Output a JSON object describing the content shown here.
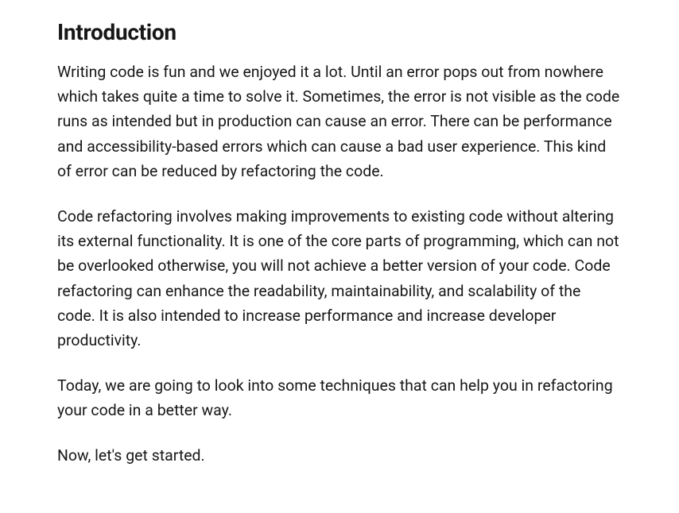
{
  "section": {
    "heading": "Introduction",
    "paragraphs": [
      "Writing code is fun and we enjoyed it a lot. Until an error pops out from nowhere which takes quite a time to solve it. Sometimes, the error is not visible as the code runs as intended but in production can cause an error. There can be performance and accessibility-based errors which can cause a bad user experience. This kind of error can be reduced by refactoring the code.",
      "Code refactoring involves making improvements to existing code without altering its external functionality. It is one of the core parts of programming, which can not be overlooked otherwise, you will not achieve a better version of your code. Code refactoring can enhance the readability, maintainability, and scalability of the code. It is also intended to increase performance and increase developer productivity.",
      "Today, we are going to look into some techniques that can help you in refactoring your code in a better way.",
      "Now, let's get started."
    ]
  }
}
